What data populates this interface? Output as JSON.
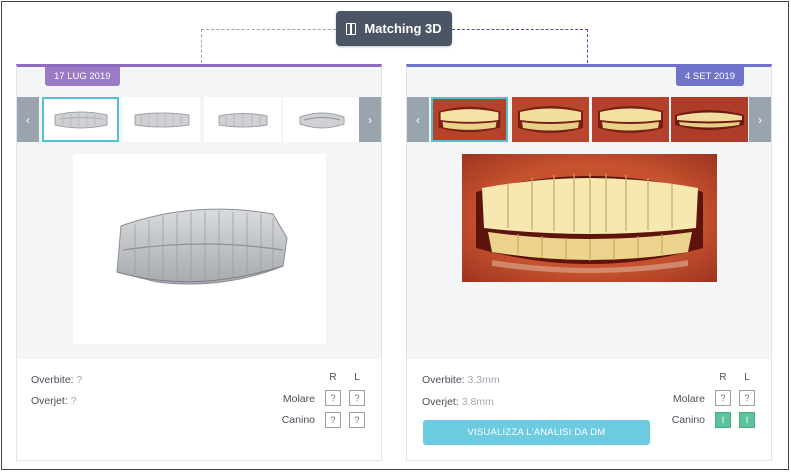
{
  "header": {
    "match_button_label": "Matching 3D"
  },
  "panel_left": {
    "date": "17 LUG 2019",
    "nav_prev": "‹",
    "nav_next": "›",
    "overbite_label": "Overbite:",
    "overbite_value": "?",
    "overjet_label": "Overjet:",
    "overjet_value": "?",
    "col_r": "R",
    "col_l": "L",
    "molare_label": "Molare",
    "canino_label": "Canino",
    "molare_r": "?",
    "molare_l": "?",
    "canino_r": "?",
    "canino_l": "?"
  },
  "panel_right": {
    "date": "4 SET 2019",
    "nav_prev": "‹",
    "nav_next": "›",
    "overbite_label": "Overbite:",
    "overbite_value": "3.3mm",
    "overjet_label": "Overjet:",
    "overjet_value": "3.8mm",
    "col_r": "R",
    "col_l": "L",
    "molare_label": "Molare",
    "canino_label": "Canino",
    "molare_r": "?",
    "molare_l": "?",
    "canino_r": "I",
    "canino_l": "I",
    "cta_label": "VISUALIZZA L'ANALISI DA DM"
  },
  "colors": {
    "accent_left": "#9b7ac6",
    "accent_right": "#6f73c9",
    "selection": "#52c0cf",
    "cta": "#6ccbe0",
    "status_green": "#5cc49a"
  }
}
